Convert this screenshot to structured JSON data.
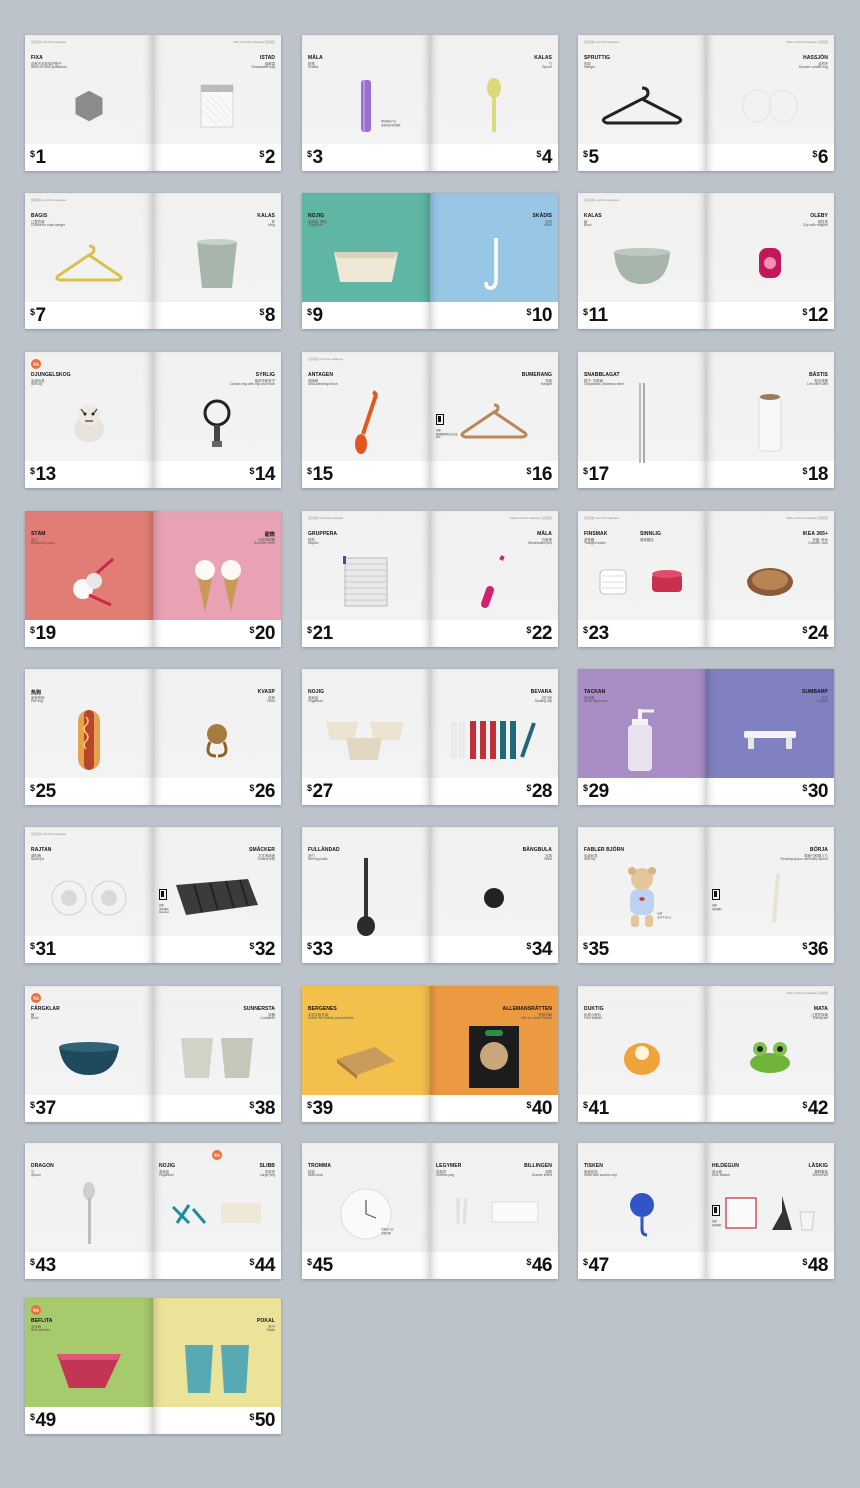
{
  "spreads": [
    {
      "left": {
        "name": "FIXA",
        "sub": "自粘式毛毡保护垫子",
        "sub2": "Stick-on floor protectors",
        "price": "1",
        "hdr": "宜家家居 Low Price Catalogue"
      },
      "right": {
        "name": "ISTAD",
        "sub": "保鲜袋",
        "sub2": "Resealable bag",
        "price": "2",
        "hdr": "IKEA Low Price Catalogue 宜家家居"
      }
    },
    {
      "left": {
        "name": "MÅLA",
        "sub": "粉笔",
        "sub2": "Chalks",
        "price": "3",
        "note": "粗壮抹色产品\n更多色彩可供选择"
      },
      "right": {
        "name": "KALAS",
        "sub": "勺",
        "sub2": "Spoon",
        "price": "4"
      }
    },
    {
      "left": {
        "name": "SPRUTTIG",
        "sub": "衣架",
        "sub2": "Hanger",
        "price": "5",
        "hdr": "宜家家居 Low Price Catalogue"
      },
      "right": {
        "name": "HASSJÖN",
        "sub": "浴帘环",
        "sub2": "Shower curtain ring",
        "price": "6",
        "hdr": "IKEA Low Price Catalogue 宜家家居"
      }
    },
    {
      "left": {
        "name": "BAGIS",
        "sub": "儿童衣架",
        "sub2": "Children's coat-hanger",
        "price": "7",
        "hdr": "宜家家居 Low Price Catalogue"
      },
      "right": {
        "name": "KALAS",
        "sub": "杯",
        "sub2": "Mug",
        "price": "8"
      }
    },
    {
      "left": {
        "name": "NOJIG",
        "sub": "收纳盒, 塑料",
        "sub2": "Organiser",
        "price": "9",
        "color": "#60b6a4"
      },
      "right": {
        "name": "SKÅDIS",
        "sub": "挂钩",
        "sub2": "Hook",
        "price": "10",
        "color": "#98c7e6"
      }
    },
    {
      "left": {
        "name": "KALAS",
        "sub": "碗",
        "sub2": "Bowl",
        "price": "11",
        "hdr": "宜家家居 Low Price Catalogue"
      },
      "right": {
        "name": "OLEBY",
        "sub": "磁性夹",
        "sub2": "Clip with magnet",
        "price": "12"
      }
    },
    {
      "left": {
        "name": "DJUNGELSKOG",
        "sub": "毛绒玩具",
        "sub2": "Soft toy",
        "price": "13",
        "badge": "新品"
      },
      "right": {
        "name": "SYRLIG",
        "sub": "窗帘环和夹子",
        "sub2": "Curtain ring with clip and hook",
        "price": "14"
      }
    },
    {
      "left": {
        "name": "ANTAGEN",
        "sub": "洗碗刷",
        "sub2": "Dish-washing brush",
        "price": "15",
        "hdr": "宜家家居 Low Price Catalogue"
      },
      "right": {
        "name": "BUMERANG",
        "sub": "衣架",
        "sub2": "Hanger",
        "price": "16",
        "boxnote": "宜家\n森林管理委员会认证\nFSC"
      }
    },
    {
      "left": {
        "name": "SNABBLAGAT",
        "sub": "筷子, 不锈钢",
        "sub2": "Chopsticks, stainless steel",
        "price": "17"
      },
      "right": {
        "name": "BÄSTIS",
        "sub": "粘毛滚筒",
        "sub2": "Lint roller with",
        "price": "18"
      }
    },
    {
      "left": {
        "name": "STÄM",
        "sub": "量勺",
        "sub2": "Measuring cups",
        "price": "19",
        "color": "#e17d74"
      },
      "right": {
        "name": "甜筒",
        "sub": "冰淇淋甜筒",
        "sub2": "Summer cone",
        "price": "20",
        "color": "#e9a1b6"
      }
    },
    {
      "left": {
        "name": "GRUPPERA",
        "sub": "抹布",
        "sub2": "Napkin",
        "price": "21",
        "hdr": "宜家家居 Low Price Catalogue"
      },
      "right": {
        "name": "MÅLA",
        "sub": "白板笔",
        "sub2": "Whiteboard pen",
        "price": "22",
        "hdr": "IKEA Low Price Catalogue 宜家家居"
      }
    },
    {
      "left": {
        "name": "FINSMAK",
        "sub": "滤茶器",
        "sub2": "Tealight holder",
        "name2": "SINNLIG",
        "sub_b": "香味蜡烛",
        "price": "23",
        "hdr": "宜家家居 Low Price Catalogue"
      },
      "right": {
        "name": "IKEA 365+",
        "sub": "托盘, 软木",
        "sub2": "Coaster, cork",
        "price": "24",
        "hdr": "IKEA Low Price Catalogue 宜家家居"
      }
    },
    {
      "left": {
        "name": "热狗",
        "sub": "宜家热狗",
        "sub2": "Hot dog",
        "price": "25"
      },
      "right": {
        "name": "KVASP",
        "sub": "挂钩",
        "sub2": "Hook",
        "price": "26"
      }
    },
    {
      "left": {
        "name": "NOJIG",
        "sub": "收纳盒",
        "sub2": "Organiser",
        "price": "27"
      },
      "right": {
        "name": "BEVARA",
        "sub": "封口夹",
        "sub2": "Sealing clip",
        "price": "28"
      }
    },
    {
      "left": {
        "name": "TACKAN",
        "sub": "皂液器",
        "sub2": "Soap dispenser",
        "price": "29",
        "color": "#a88ec5"
      },
      "right": {
        "name": "SUMBARP",
        "sub": "拉手",
        "sub2": "Handle",
        "price": "30",
        "color": "#8181c1"
      }
    },
    {
      "left": {
        "name": "RAJTAN",
        "sub": "调料瓶",
        "sub2": "Spice jar",
        "price": "31",
        "hdr": "宜家家居 Low Price Catalogue"
      },
      "right": {
        "name": "SMÄCKER",
        "sub": "刀叉收纳盘",
        "sub2": "Cutlery tray",
        "price": "32",
        "boxnote": "宜家\n环保材料\nRecycled"
      }
    },
    {
      "left": {
        "name": "FULLÄNDAD",
        "sub": "汤勺",
        "sub2": "Serving ladle",
        "price": "33"
      },
      "right": {
        "name": "BÅNGBULA",
        "sub": "挂钩",
        "sub2": "Hook",
        "price": "34"
      }
    },
    {
      "left": {
        "name": "FABLER BJÖRN",
        "sub": "毛绒玩具",
        "sub2": "Soft toy",
        "price": "35",
        "note": "玩具\n适合 0 岁以上"
      },
      "right": {
        "name": "BÖRJA",
        "sub": "喂食勺和婴儿勺",
        "sub2": "Feeding spoon and baby spoon",
        "price": "36",
        "boxnote": "宜家\n环保材料"
      }
    },
    {
      "left": {
        "name": "FÄRGKLAR",
        "sub": "碗",
        "sub2": "Bowl",
        "price": "37",
        "badge": "新品"
      },
      "right": {
        "name": "SUNNERSTA",
        "sub": "容器",
        "sub2": "Container",
        "price": "38"
      }
    },
    {
      "left": {
        "name": "BERGENES",
        "sub": "手机平板支架",
        "sub2": "Holder for mobile phone/tablet",
        "price": "39",
        "color": "#f2c04b"
      },
      "right": {
        "name": "ALLEMANSRÄTTEN",
        "sub": "蘑菇汤酱",
        "sub2": "Mix for cream sauce",
        "price": "40",
        "color": "#ec9a42"
      }
    },
    {
      "left": {
        "name": "DUKTIG",
        "sub": "玩具小面包",
        "sub2": "Fruit basket",
        "price": "41"
      },
      "right": {
        "name": "MATA",
        "sub": "儿童吃饭碗",
        "sub2": "Eating set",
        "price": "42",
        "hdr": "IKEA Low Price Catalogue 宜家家居"
      }
    },
    {
      "left": {
        "name": "DRAGON",
        "sub": "勺",
        "sub2": "Spoon",
        "price": "43"
      },
      "right": {
        "name": "SLIBB",
        "sub": "衣架夹",
        "sub2": "Large peg",
        "name2": "NOJIG",
        "sub_b": "收纳盒",
        "sub2_b": "Organiser",
        "price": "44",
        "badge": "新品"
      }
    },
    {
      "left": {
        "name": "TROMMA",
        "sub": "挂钟",
        "sub2": "Wall clock",
        "price": "45",
        "note": "低电压产品\n电池另购"
      },
      "right": {
        "name": "BILLINGEN",
        "sub": "抽屉",
        "sub2": "Drawer insert",
        "name2": "LEGYMER",
        "sub_b": "衣架夹",
        "sub2_b": "Clothes peg",
        "price": "46"
      }
    },
    {
      "left": {
        "name": "TISKEN",
        "sub": "吸盘挂钩",
        "sub2": "Hook with suction cup",
        "price": "47"
      },
      "right": {
        "name": "LÄSKIG",
        "sub": "簸箕套装",
        "sub2": "Broom set",
        "name2": "HILDEGUN",
        "sub_b": "沥水垫",
        "sub2_b": "Dish drainer",
        "price": "48",
        "boxnote": "宜家\n环保材料"
      }
    },
    {
      "left": {
        "name": "BEFLITA",
        "sub": "沥水碗",
        "sub2": "Sink strainer",
        "price": "49",
        "badge": "新品",
        "color": "#a7ca6c"
      },
      "right": {
        "name": "POKAL",
        "sub": "杯子",
        "sub2": "Glass",
        "price": "50",
        "color": "#ece39b"
      }
    }
  ],
  "currency_symbol": "$",
  "colors": {
    "background": "#bcc3cb",
    "orange_badge": "#ef6e37"
  }
}
